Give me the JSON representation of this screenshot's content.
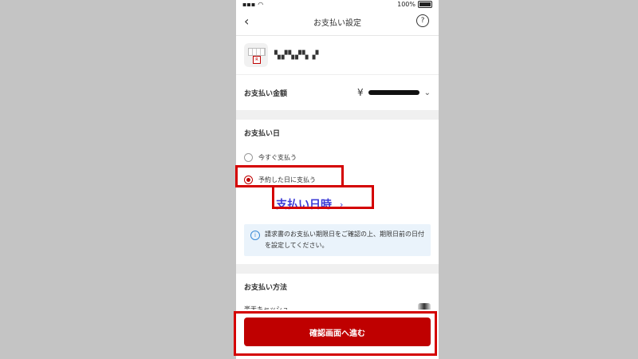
{
  "status_bar": {
    "battery_text": "100%"
  },
  "nav": {
    "title": "お支払い設定",
    "back_icon": "chevron-left-icon",
    "help_icon": "question-icon"
  },
  "merchant": {
    "name": "▚▞▚▞▚ ▞"
  },
  "amount": {
    "label": "お支払い金額",
    "currency": "¥"
  },
  "payment_date": {
    "heading": "お支払い日",
    "options": [
      {
        "label": "今すぐ支払う",
        "checked": false
      },
      {
        "label": "予約した日に支払う",
        "checked": true
      }
    ],
    "date_picker_label": "支払い日時",
    "info": "請求書のお支払い期限日をご確認の上、期限日前の日付を設定してください。"
  },
  "payment_method": {
    "heading": "お支払い方法",
    "method": "楽天キャッシュ"
  },
  "footer": {
    "confirm_label": "確認画面へ進む"
  },
  "colors": {
    "accent": "#bf0000",
    "highlight": "#d40000",
    "info_bg": "#eaf3fb",
    "date_text": "#3a3ad6"
  }
}
